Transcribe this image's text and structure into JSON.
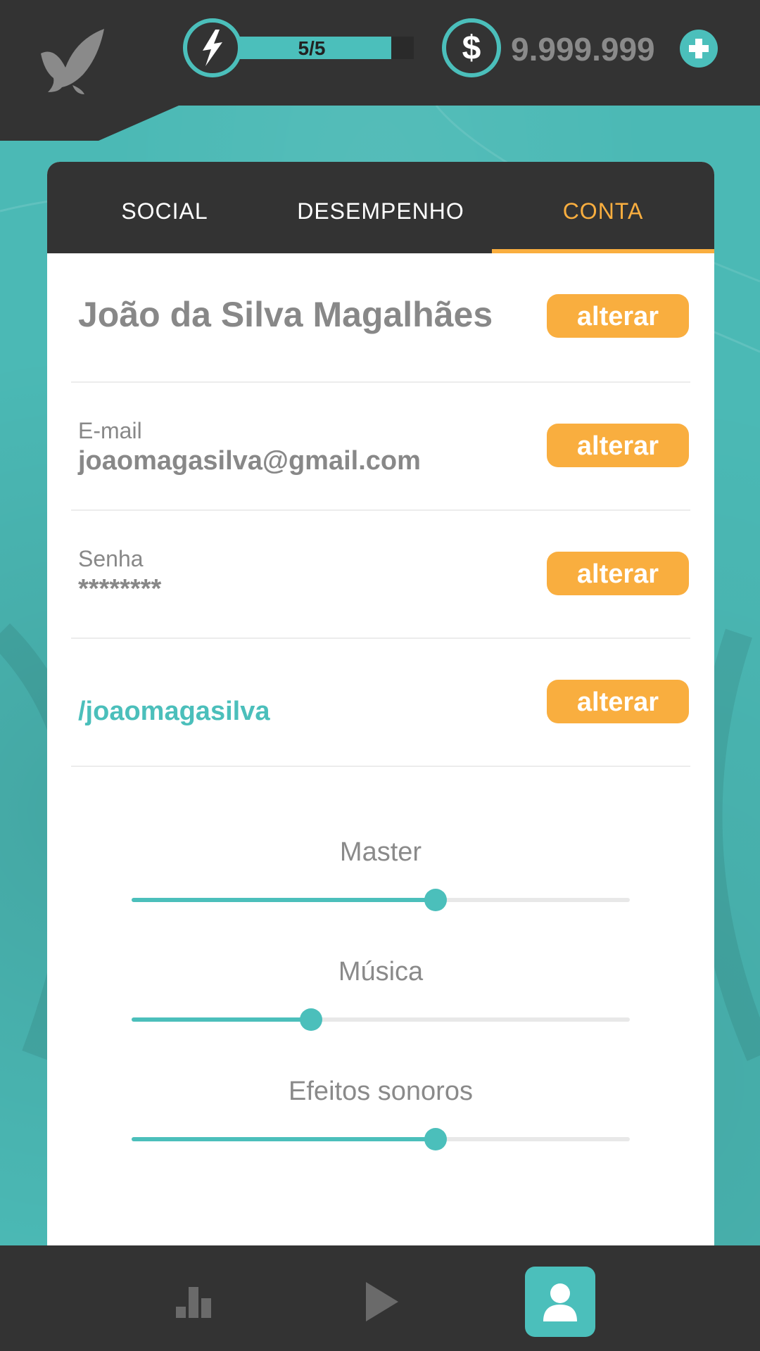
{
  "header": {
    "logo_icon": "bird-logo-icon",
    "energy": {
      "label": "5/5",
      "current": 5,
      "max": 5,
      "icon": "lightning-icon"
    },
    "coins": {
      "icon": "dollar-coin-icon",
      "symbol": "$",
      "value": "9.999.999"
    },
    "add_icon": "plus-icon"
  },
  "tabs": [
    {
      "label": "SOCIAL",
      "active": false
    },
    {
      "label": "DESEMPENHO",
      "active": false
    },
    {
      "label": "CONTA",
      "active": true
    }
  ],
  "account": {
    "name": "João da Silva Magalhães",
    "email_label": "E-mail",
    "email": "joaomagasilva@gmail.com",
    "password_label": "Senha",
    "password": "********",
    "handle": "/joaomagasilva",
    "change_label": "alterar"
  },
  "audio": {
    "master": {
      "label": "Master",
      "level": 0.61
    },
    "music": {
      "label": "Música",
      "level": 0.36
    },
    "effects": {
      "label": "Efeitos sonoros",
      "level": 0.61
    }
  },
  "nav": {
    "items": [
      {
        "icon": "bar-chart-icon",
        "active": false
      },
      {
        "icon": "play-icon",
        "active": false
      },
      {
        "icon": "user-profile-icon",
        "active": true
      }
    ]
  },
  "colors": {
    "teal": "#4bbfbb",
    "orange": "#f9ae3f",
    "dark": "#333333",
    "gray_text": "#888888"
  }
}
